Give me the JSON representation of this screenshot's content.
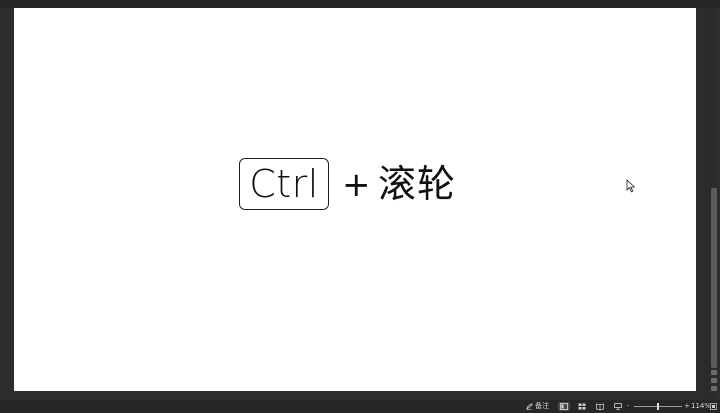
{
  "slide": {
    "key_label": "Ctrl",
    "plus": "+",
    "action_text": "滚轮"
  },
  "status_bar": {
    "notes_label": "备注",
    "zoom_minus": "-",
    "zoom_plus": "+",
    "zoom_level": "114%",
    "zoom_fraction": 0.5
  },
  "colors": {
    "slide_background": "#ffffff",
    "window_background": "#2d2d2d",
    "status_bar_background": "#262626",
    "text": "#111111"
  },
  "icons": {
    "cursor": "mouse-pointer-icon",
    "notes": "notes-icon",
    "normal_view": "normal-view-icon",
    "slide_sorter": "slide-sorter-icon",
    "reading_view": "reading-view-icon",
    "slideshow": "slideshow-icon",
    "fit": "fit-to-window-icon"
  }
}
